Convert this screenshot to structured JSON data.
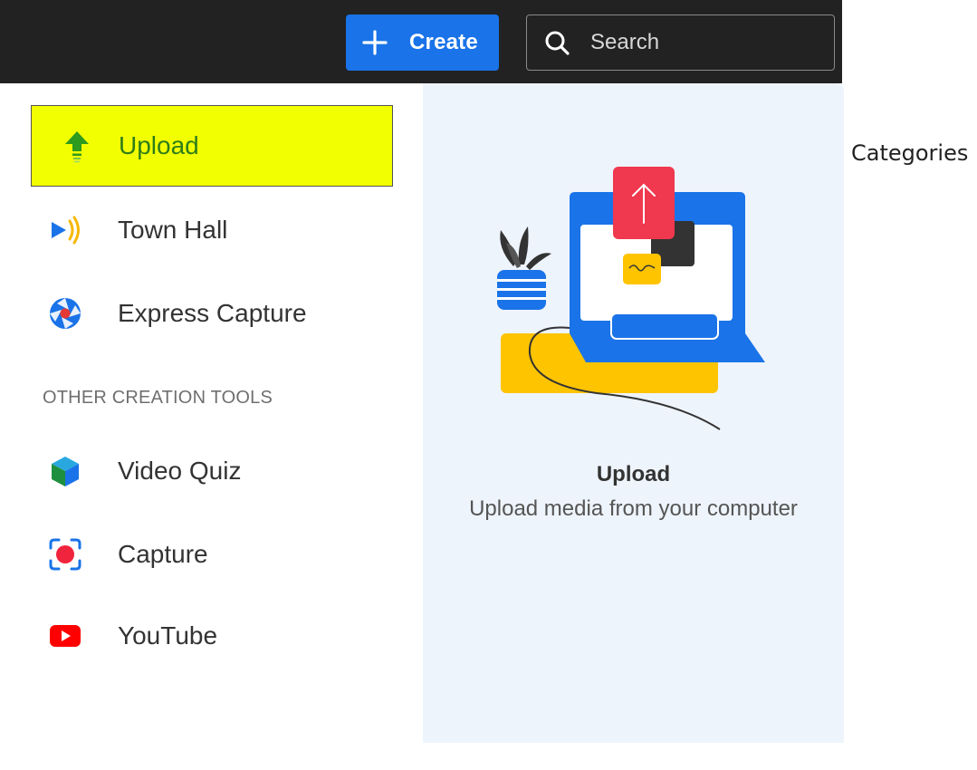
{
  "header": {
    "create_label": "Create",
    "search_placeholder": "Search"
  },
  "menu": {
    "items": [
      {
        "label": "Upload",
        "icon": "upload-arrow-icon",
        "active": true
      },
      {
        "label": "Town Hall",
        "icon": "town-hall-broadcast-icon"
      },
      {
        "label": "Express Capture",
        "icon": "express-capture-icon"
      }
    ],
    "section_header": "OTHER CREATION TOOLS",
    "other_items": [
      {
        "label": "Video Quiz",
        "icon": "video-quiz-cube-icon"
      },
      {
        "label": "Capture",
        "icon": "capture-record-icon"
      },
      {
        "label": "YouTube",
        "icon": "youtube-icon"
      }
    ]
  },
  "preview": {
    "title": "Upload",
    "description": "Upload media from your computer"
  },
  "side": {
    "categories_label": "Categories"
  },
  "colors": {
    "topbar": "#222222",
    "accent_blue": "#1a73e8",
    "highlight": "#f2ff00",
    "preview_bg": "#eef4fc",
    "upload_green": "#2e7d19"
  }
}
